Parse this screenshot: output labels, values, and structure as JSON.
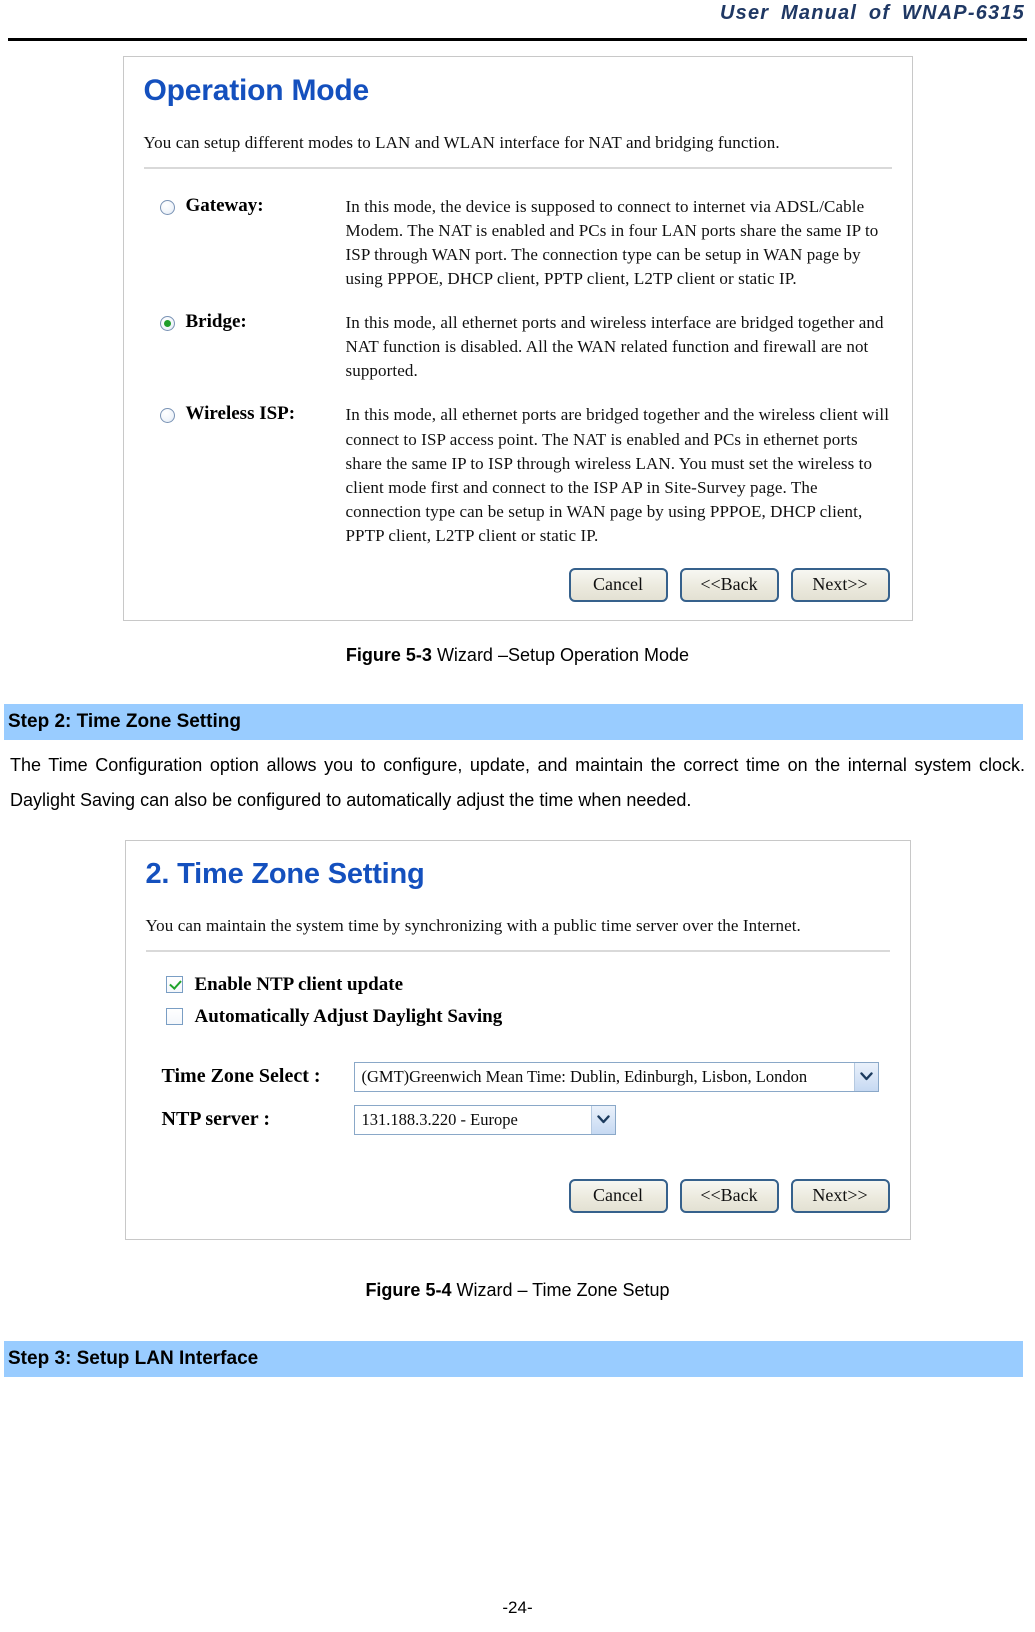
{
  "document": {
    "header_title": "User Manual of WNAP-6315",
    "page_number": "-24-"
  },
  "figure_operation_mode": {
    "panel_title": "Operation Mode",
    "panel_description": "You can setup different modes to LAN and WLAN interface for NAT and bridging function.",
    "options": [
      {
        "label": "Gateway:",
        "selected": false,
        "description": "In this mode, the device is supposed to connect to internet via ADSL/Cable Modem. The NAT is enabled and PCs in four LAN ports share the same IP to ISP through WAN port. The connection type can be setup in WAN page by using PPPOE, DHCP client, PPTP client, L2TP client or static IP."
      },
      {
        "label": "Bridge:",
        "selected": true,
        "description": "In this mode, all ethernet ports and wireless interface are bridged together and NAT function is disabled. All the WAN related function and firewall are not supported."
      },
      {
        "label": "Wireless ISP:",
        "selected": false,
        "description": "In this mode, all ethernet ports are bridged together and the wireless client will connect to ISP access point. The NAT is enabled and PCs in ethernet ports share the same IP to ISP through wireless LAN. You must set the wireless to client mode first and connect to the ISP AP in Site-Survey page. The connection type can be setup in WAN page by using PPPOE, DHCP client, PPTP client, L2TP client or static IP."
      }
    ],
    "buttons": {
      "cancel": "Cancel",
      "back": "<<Back",
      "next": "Next>>"
    },
    "caption_bold": "Figure 5-3",
    "caption_rest": " Wizard –Setup Operation Mode"
  },
  "step2": {
    "bar_label": "Step 2: Time Zone Setting",
    "paragraph": "The Time Configuration option allows you to configure, update, and maintain the correct time on the internal system clock. Daylight Saving can also be configured to automatically adjust the time when needed."
  },
  "figure_time_zone": {
    "panel_title": "2. Time Zone Setting",
    "panel_description": "You can maintain the system time by synchronizing with a public time server over the Internet.",
    "checkboxes": [
      {
        "label": "Enable NTP client update",
        "checked": true
      },
      {
        "label": "Automatically Adjust Daylight Saving",
        "checked": false
      }
    ],
    "time_zone_label": "Time Zone Select :",
    "time_zone_value": "(GMT)Greenwich Mean Time: Dublin, Edinburgh, Lisbon, London",
    "ntp_server_label": "NTP server :",
    "ntp_server_value": "131.188.3.220 - Europe",
    "buttons": {
      "cancel": "Cancel",
      "back": "<<Back",
      "next": "Next>>"
    },
    "caption_bold": "Figure 5-4",
    "caption_rest": " Wizard – Time Zone Setup"
  },
  "step3": {
    "bar_label": "Step 3: Setup LAN Interface"
  },
  "colors": {
    "step_bar_blue": "#99CCFF",
    "panel_title_blue": "#1450BE",
    "header_navy": "#1F3864",
    "radio_green": "#1F9E2A",
    "button_border_blue": "#36618C"
  }
}
